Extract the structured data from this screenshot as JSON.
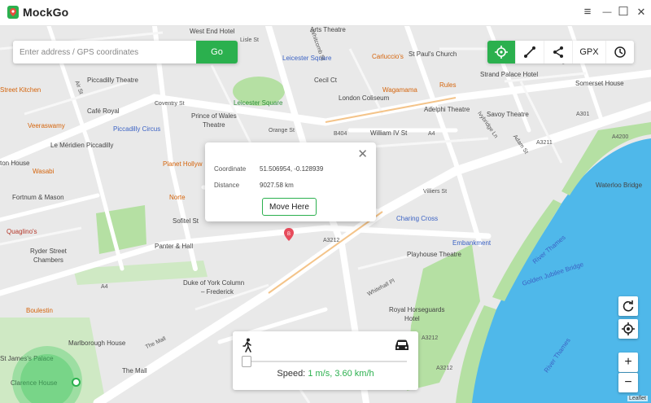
{
  "app": {
    "title": "MockGo"
  },
  "window_controls": {
    "menu": "≡",
    "minimize": "—",
    "maximize": "☐",
    "close": "✕"
  },
  "search": {
    "placeholder": "Enter address / GPS coordinates",
    "go_label": "Go"
  },
  "toolbar": {
    "gpx_label": "GPX",
    "icons": [
      "crosshair-icon",
      "route-icon",
      "share-icon",
      "history-icon"
    ]
  },
  "popup": {
    "coordinate_label": "Coordinate",
    "coordinate_value": "51.506954, -0.128939",
    "distance_label": "Distance",
    "distance_value": "9027.58 km",
    "move_button": "Move Here"
  },
  "speed_panel": {
    "label": "Speed:",
    "value": "1 m/s, 3.60 km/h",
    "slider_fraction": 0.0
  },
  "map_controls": {
    "zoom_in": "+",
    "zoom_out": "−"
  },
  "attribution": "Leaflet",
  "colors": {
    "accent": "#2bb04e",
    "water": "#4fb8ea",
    "park": "#b5e0a3",
    "land": "#e9e9e9"
  },
  "map_labels": {
    "west_end_hotel": "West End Hotel",
    "arts_theatre": "Arts Theatre",
    "lisle_st": "Lisle St",
    "leicester_square_stn": "Leicester Square",
    "carluccios": "Carluccio's",
    "st_pauls_church": "St Paul's Church",
    "strand_palace": "Strand Palace Hotel",
    "somerset_house": "Somerset House",
    "street_kitchen": "Street Kitchen",
    "piccadilly_theatre": "Piccadilly Theatre",
    "cecil_ct": "Cecil Ct",
    "wagamama": "Wagamama",
    "rules": "Rules",
    "cafe_royal": "Café Royal",
    "coventry_st": "Coventry St",
    "leicester_square_park": "Leicester Square",
    "london_coliseum": "London Coliseum",
    "adelphi": "Adelphi Theatre",
    "savoy": "Savoy Theatre",
    "veeraswamy": "Veeraswamy",
    "piccadilly_circus": "Piccadilly Circus",
    "prince_wales_1": "Prince of Wales",
    "prince_wales_2": "Theatre",
    "orange_st": "Orange St",
    "b404": "B404",
    "william_iv": "William IV St",
    "a4": "A4",
    "a301": "A301",
    "a3211": "A3211",
    "a4200": "A4200",
    "meridien": "Le Méridien Piccadilly",
    "ton_house": "ton House",
    "wasabi": "Wasabi",
    "planet_hollywood": "Planet Hollyw",
    "fortnum": "Fortnum & Mason",
    "norte": "Norte",
    "sofitel": "Sofitel St",
    "villiers_st": "Villiers St",
    "charing_cross": "Charing Cross",
    "waterloo_bridge": "Waterloo Bridge",
    "quaglinos": "Quaglino's",
    "panter_hall": "Panter & Hall",
    "a3212": "A3212",
    "embankment": "Embankment",
    "river_thames_1": "River Thames",
    "ryder_1": "Ryder Street",
    "ryder_2": "Chambers",
    "playhouse": "Playhouse Theatre",
    "golden_jubilee": "Golden Jubilee Bridge",
    "duke_york_1": "Duke of York Column",
    "duke_york_2": "– Frederick",
    "whitehall_pl": "Whitehall Pl",
    "boulestin": "Boulestin",
    "royal_horseguards_1": "Royal Horseguards",
    "royal_horseguards_2": "Hotel",
    "the_mall": "The Mall",
    "marlborough": "Marlborough House",
    "st_james_palace": "St James's Palace",
    "clarence_house": "Clarence House",
    "the_mall_2": "The Mall",
    "a3212_b": "A3212",
    "a4_b": "A4",
    "river_thames_2": "River Thames",
    "a3212_c": "A3212",
    "air_st": "Air St",
    "whitcomb": "Whitcomb St",
    "ivybridge": "Ivybridge Ln",
    "adam_st": "Adam St",
    "strand_label": "Strand"
  }
}
